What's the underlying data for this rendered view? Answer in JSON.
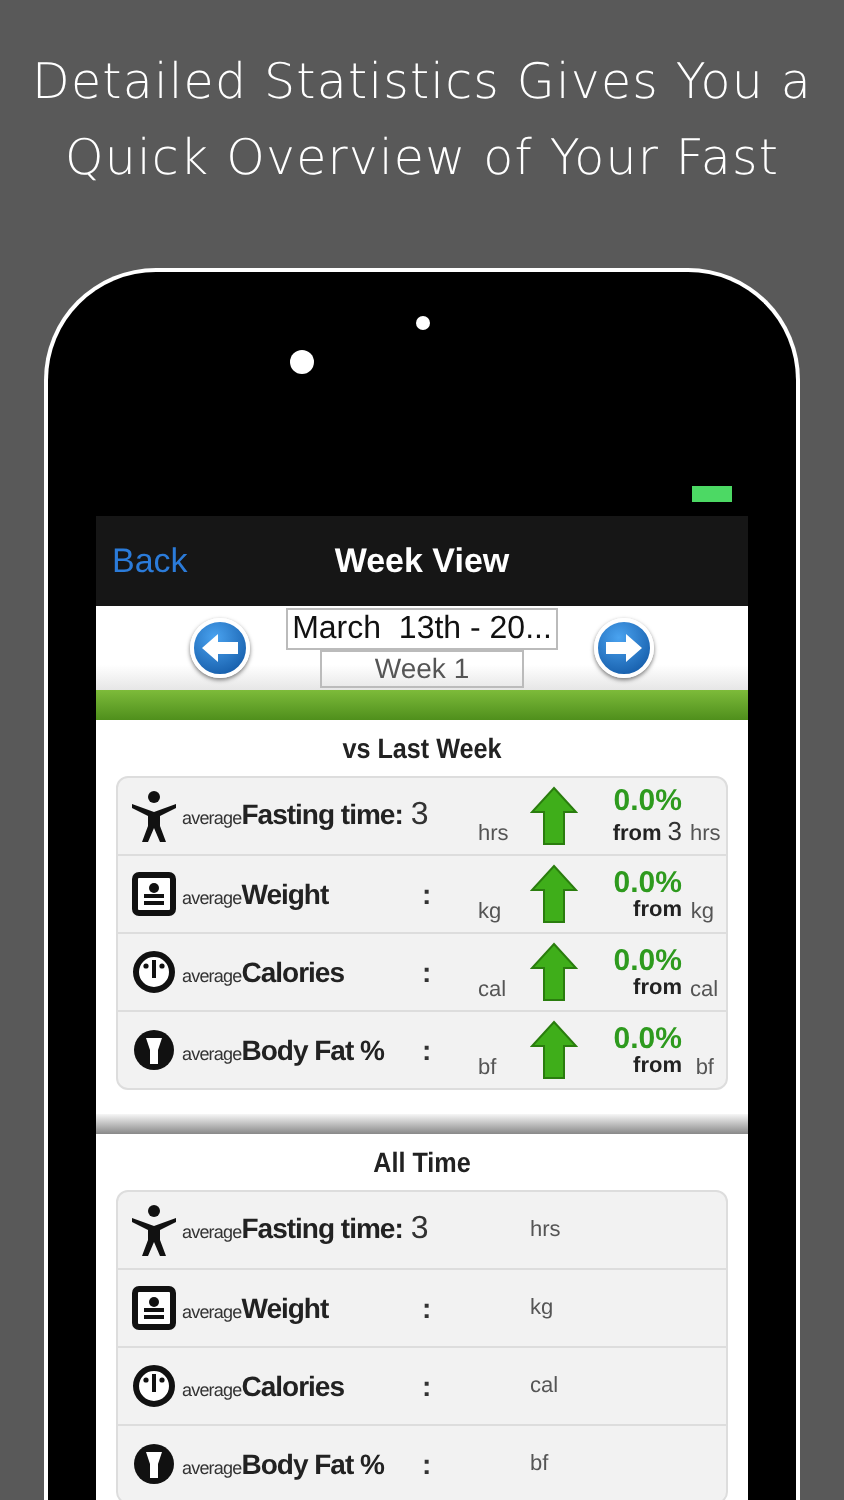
{
  "headline": "Detailed Statistics Gives You a Quick Overview of Your Fast",
  "nav": {
    "back": "Back",
    "title": "Week View"
  },
  "period": {
    "range": "March  13th - 20...",
    "week": "Week 1"
  },
  "sections": [
    {
      "title": "vs Last Week",
      "rows": [
        {
          "kind": "person",
          "prefix": "average",
          "label": "Fasting time:",
          "value": "3",
          "unit": "hrs",
          "rising": true,
          "change": "0.0%",
          "from": "from",
          "from_value": "3",
          "from_unit": "hrs"
        },
        {
          "kind": "scale",
          "prefix": "average",
          "label": "Weight",
          "separator": ":",
          "unit": "kg",
          "rising": true,
          "change": "0.0%",
          "from": "from",
          "from_unit": "kg"
        },
        {
          "kind": "gauge",
          "prefix": "average",
          "label": "Calories",
          "separator": ":",
          "unit": "cal",
          "rising": true,
          "change": "0.0%",
          "from": "from",
          "from_unit": "cal"
        },
        {
          "kind": "bodyfat",
          "prefix": "average",
          "label": "Body Fat %",
          "separator": ":",
          "unit": "bf",
          "rising": true,
          "change": "0.0%",
          "from": "from",
          "from_unit": "bf"
        }
      ]
    },
    {
      "title": "All Time",
      "rows": [
        {
          "kind": "person",
          "prefix": "average",
          "label": "Fasting time:",
          "value": "3",
          "unit": "hrs"
        },
        {
          "kind": "scale",
          "prefix": "average",
          "label": "Weight",
          "separator": ":",
          "unit": "kg"
        },
        {
          "kind": "gauge",
          "prefix": "average",
          "label": "Calories",
          "separator": ":",
          "unit": "cal"
        },
        {
          "kind": "bodyfat",
          "prefix": "average",
          "label": "Body Fat %",
          "separator": ":",
          "unit": "bf"
        }
      ]
    }
  ]
}
